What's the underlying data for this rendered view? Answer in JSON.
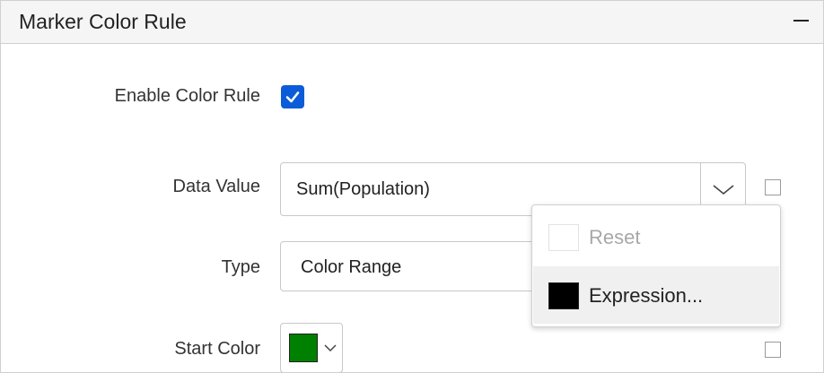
{
  "panel": {
    "title": "Marker Color Rule"
  },
  "fields": {
    "enable_color_rule": {
      "label": "Enable Color Rule",
      "checked": true
    },
    "data_value": {
      "label": "Data Value",
      "value": "Sum(Population)"
    },
    "type": {
      "label": "Type",
      "value": "Color Range"
    },
    "start_color": {
      "label": "Start Color",
      "color": "#008000"
    }
  },
  "context_menu": {
    "items": [
      {
        "label": "Reset",
        "enabled": false
      },
      {
        "label": "Expression...",
        "enabled": true,
        "highlighted": true
      }
    ]
  },
  "colors": {
    "accent": "#0b5cd8",
    "start_color_swatch": "#008000",
    "expression_swatch": "#000000"
  }
}
